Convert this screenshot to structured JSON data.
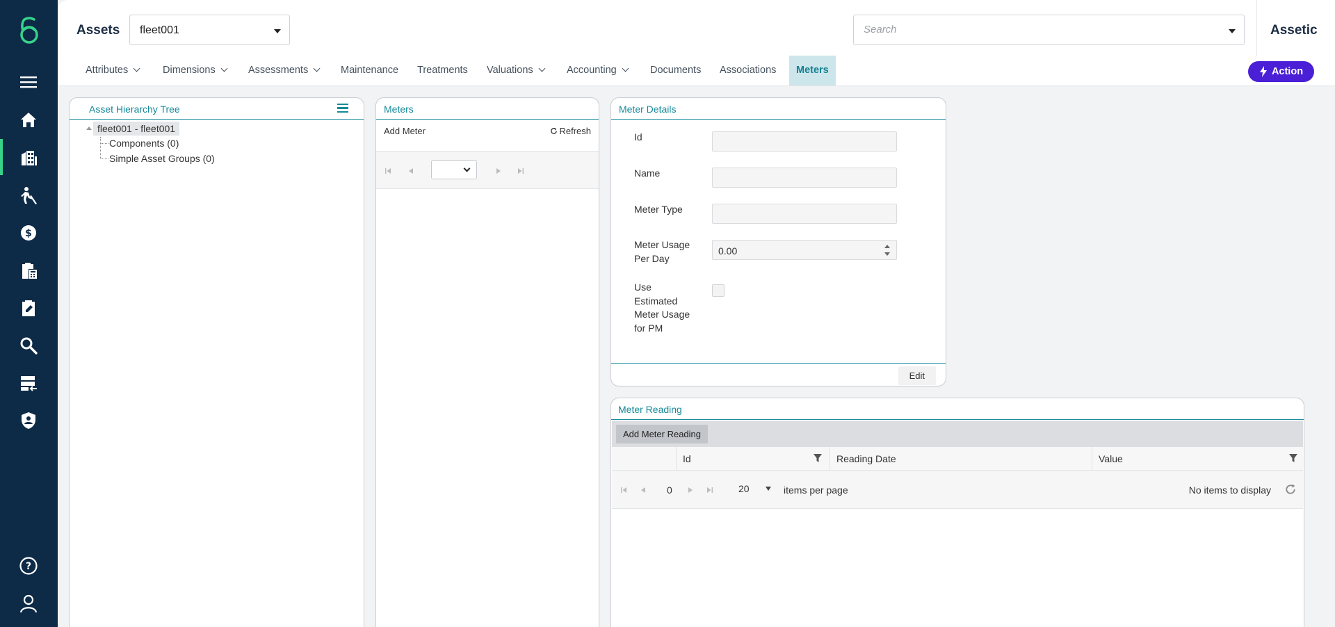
{
  "rail": {
    "items": [
      {
        "name": "logo-icon"
      },
      {
        "name": "menu-icon"
      },
      {
        "name": "home-icon"
      },
      {
        "name": "buildings-icon"
      },
      {
        "name": "worker-icon"
      },
      {
        "name": "finance-icon"
      },
      {
        "name": "clipboard-calculator-icon"
      },
      {
        "name": "clipboard-edit-icon"
      },
      {
        "name": "search-icon"
      },
      {
        "name": "import-icon"
      },
      {
        "name": "shield-user-icon"
      },
      {
        "name": "help-icon"
      },
      {
        "name": "user-icon"
      }
    ],
    "accent": "#36d38a",
    "background": "#0d2a47"
  },
  "header": {
    "module": "Assets",
    "asset_selected": "fleet001",
    "search_placeholder": "Search",
    "brand": "Assetic"
  },
  "tabs": [
    {
      "label": "Attributes",
      "dropdown": true
    },
    {
      "label": "Dimensions",
      "dropdown": true
    },
    {
      "label": "Assessments",
      "dropdown": true
    },
    {
      "label": "Maintenance",
      "dropdown": false
    },
    {
      "label": "Treatments",
      "dropdown": false
    },
    {
      "label": "Valuations",
      "dropdown": true
    },
    {
      "label": "Accounting",
      "dropdown": true
    },
    {
      "label": "Documents",
      "dropdown": false
    },
    {
      "label": "Associations",
      "dropdown": false
    },
    {
      "label": "Meters",
      "dropdown": false,
      "active": true
    }
  ],
  "action_button": {
    "label": "Action",
    "color": "#4a1fd6"
  },
  "hierarchy": {
    "title": "Asset Hierarchy Tree",
    "root": "fleet001 - fleet001",
    "children": [
      "Components (0)",
      "Simple Asset Groups (0)"
    ]
  },
  "meters": {
    "title": "Meters",
    "add_label": "Add Meter",
    "refresh_label": "Refresh"
  },
  "meter_details": {
    "title": "Meter Details",
    "fields": {
      "id_label": "Id",
      "name_label": "Name",
      "type_label": "Meter Type",
      "usage_label_1": "Meter Usage",
      "usage_label_2": "Per Day",
      "usage_value": "0.00",
      "estimated_label_1": "Use",
      "estimated_label_2": "Estimated",
      "estimated_label_3": "Meter Usage",
      "estimated_label_4": "for PM"
    },
    "edit_label": "Edit"
  },
  "meter_reading": {
    "title": "Meter Reading",
    "add_label": "Add Meter Reading",
    "columns": [
      "Id",
      "Reading Date",
      "Value"
    ],
    "page": "0",
    "page_size": "20",
    "items_per_page": "items per page",
    "empty_text": "No items to display"
  },
  "accent_teal": "#168a99"
}
